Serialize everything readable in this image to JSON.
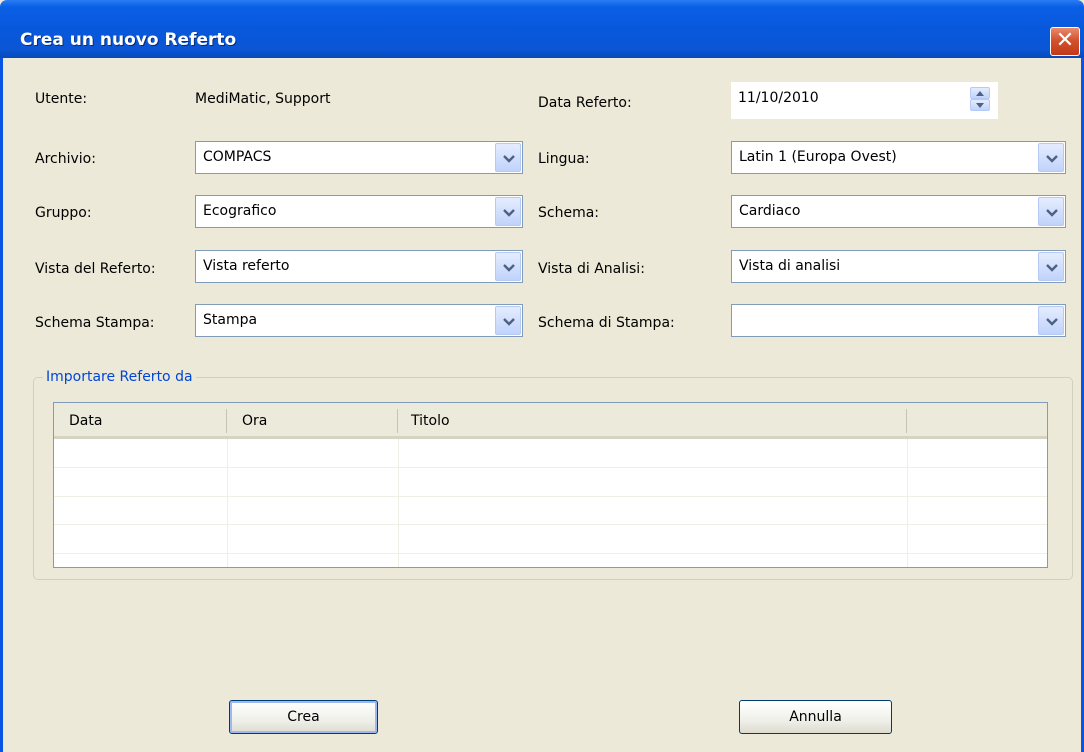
{
  "window": {
    "title": "Crea un nuovo Referto",
    "close_glyph": "✕"
  },
  "form": {
    "utente": {
      "label": "Utente:",
      "value": "MediMatic, Support"
    },
    "data_referto": {
      "label": "Data Referto:",
      "value": "11/10/2010"
    },
    "archivio": {
      "label": "Archivio:",
      "value": "COMPACS"
    },
    "lingua": {
      "label": "Lingua:",
      "value": "Latin 1 (Europa Ovest)"
    },
    "gruppo": {
      "label": "Gruppo:",
      "value": "Ecografico"
    },
    "schema": {
      "label": "Schema:",
      "value": "Cardiaco"
    },
    "vista_referto": {
      "label": "Vista del Referto:",
      "value": "Vista referto"
    },
    "vista_analisi": {
      "label": "Vista di Analisi:",
      "value": "Vista di analisi"
    },
    "schema_stampa": {
      "label": "Schema Stampa:",
      "value": "Stampa"
    },
    "schema_di_stampa": {
      "label": "Schema di Stampa:",
      "value": ""
    }
  },
  "import_group": {
    "title": "Importare Referto da",
    "columns": [
      "Data",
      "Ora",
      "Titolo",
      ""
    ],
    "rows": []
  },
  "buttons": {
    "crea": "Crea",
    "annulla": "Annulla"
  },
  "colors": {
    "titlebar": "#0a54e4",
    "dialog_bg": "#ece9d8",
    "group_title": "#0046d5",
    "close_button": "#d2532e"
  }
}
